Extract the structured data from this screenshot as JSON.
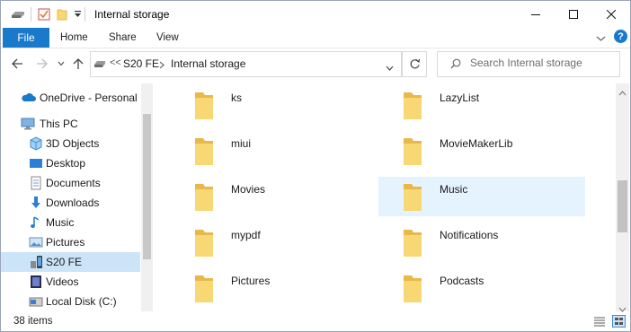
{
  "window": {
    "title": "Internal storage"
  },
  "ribbon": {
    "file": "File",
    "tabs": [
      "Home",
      "Share",
      "View"
    ]
  },
  "address": {
    "overflow": "<<",
    "crumbs": [
      "S20 FE",
      "Internal storage"
    ]
  },
  "search": {
    "placeholder": "Search Internal storage"
  },
  "nav": {
    "items": [
      {
        "label": "OneDrive - Personal",
        "icon": "cloud-icon"
      },
      {
        "label": "This PC",
        "icon": "computer-icon"
      },
      {
        "label": "3D Objects",
        "icon": "cube-icon"
      },
      {
        "label": "Desktop",
        "icon": "desktop-icon"
      },
      {
        "label": "Documents",
        "icon": "documents-icon"
      },
      {
        "label": "Downloads",
        "icon": "download-arrow-icon"
      },
      {
        "label": "Music",
        "icon": "music-note-icon"
      },
      {
        "label": "Pictures",
        "icon": "pictures-icon"
      },
      {
        "label": "S20 FE",
        "icon": "phone-icon",
        "selected": true
      },
      {
        "label": "Videos",
        "icon": "film-icon"
      },
      {
        "label": "Local Disk (C:)",
        "icon": "hard-disk-icon"
      }
    ]
  },
  "folders": [
    [
      "ks",
      "LazyList"
    ],
    [
      "miui",
      "MovieMakerLib"
    ],
    [
      "Movies",
      "Music"
    ],
    [
      "mypdf",
      "Notifications"
    ],
    [
      "Pictures",
      "Podcasts"
    ]
  ],
  "status": {
    "count": "38 items"
  },
  "colors": {
    "accent": "#1979ca",
    "folder": "#f8d775",
    "folder_dark": "#e8b84a",
    "selected_nav": "#cce4f7",
    "hover_item": "#e5f3ff"
  }
}
